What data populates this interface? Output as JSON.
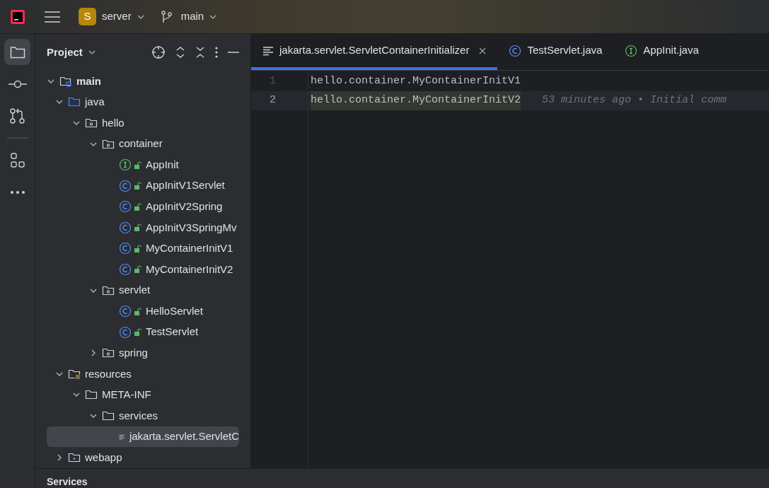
{
  "title_bar": {
    "project": {
      "letter": "S",
      "name": "server"
    },
    "branch": "main"
  },
  "tool_strip": [
    {
      "kind": "project",
      "selected": true
    },
    {
      "kind": "commit",
      "selected": false
    },
    {
      "kind": "pull-requests",
      "selected": false
    },
    {
      "kind": "separator"
    },
    {
      "kind": "structure",
      "selected": false
    },
    {
      "kind": "more",
      "selected": false
    }
  ],
  "project_panel": {
    "title": "Project",
    "tree": [
      {
        "label": "main",
        "kind": "module",
        "expanded": true,
        "selected": false,
        "children": [
          {
            "label": "java",
            "kind": "source",
            "expanded": true,
            "selected": false,
            "children": [
              {
                "label": "hello",
                "kind": "package",
                "expanded": true,
                "selected": false,
                "children": [
                  {
                    "label": "container",
                    "kind": "package",
                    "expanded": true,
                    "selected": false,
                    "children": [
                      {
                        "label": "AppInit",
                        "kind": "interface",
                        "selected": false
                      },
                      {
                        "label": "AppInitV1Servlet",
                        "kind": "class",
                        "selected": false
                      },
                      {
                        "label": "AppInitV2Spring",
                        "kind": "class",
                        "selected": false
                      },
                      {
                        "label": "AppInitV3SpringMv",
                        "kind": "class",
                        "selected": false
                      },
                      {
                        "label": "MyContainerInitV1",
                        "kind": "class",
                        "selected": false
                      },
                      {
                        "label": "MyContainerInitV2",
                        "kind": "class",
                        "selected": false
                      }
                    ]
                  },
                  {
                    "label": "servlet",
                    "kind": "package",
                    "expanded": true,
                    "selected": false,
                    "children": [
                      {
                        "label": "HelloServlet",
                        "kind": "class",
                        "selected": false
                      },
                      {
                        "label": "TestServlet",
                        "kind": "class",
                        "selected": false
                      }
                    ]
                  },
                  {
                    "label": "spring",
                    "kind": "package",
                    "expanded": false,
                    "selected": false
                  }
                ]
              }
            ]
          },
          {
            "label": "resources",
            "kind": "resources",
            "expanded": true,
            "selected": false,
            "children": [
              {
                "label": "META-INF",
                "kind": "folder",
                "expanded": true,
                "selected": false,
                "children": [
                  {
                    "label": "services",
                    "kind": "folder",
                    "expanded": true,
                    "selected": false,
                    "children": [
                      {
                        "label": "jakarta.servlet.ServletC",
                        "kind": "text",
                        "selected": true
                      }
                    ]
                  }
                ]
              }
            ]
          },
          {
            "label": "webapp",
            "kind": "web",
            "expanded": false,
            "selected": false
          }
        ]
      }
    ]
  },
  "editor": {
    "tabs": [
      {
        "label": "jakarta.servlet.ServletContainerInitializer",
        "kind": "text",
        "selected": true,
        "closable": true
      },
      {
        "label": "TestServlet.java",
        "kind": "class",
        "selected": false,
        "closable": false
      },
      {
        "label": "AppInit.java",
        "kind": "interface",
        "selected": false,
        "closable": false
      }
    ],
    "lines": [
      {
        "number": "1",
        "code": "hello.container.MyContainerInitV1",
        "current": false
      },
      {
        "number": "2",
        "code": "hello.container.MyContainerInitV2",
        "current": true,
        "blame": "53 minutes ago • Initial comm"
      }
    ]
  },
  "bottom_panel": {
    "title": "Services"
  }
}
